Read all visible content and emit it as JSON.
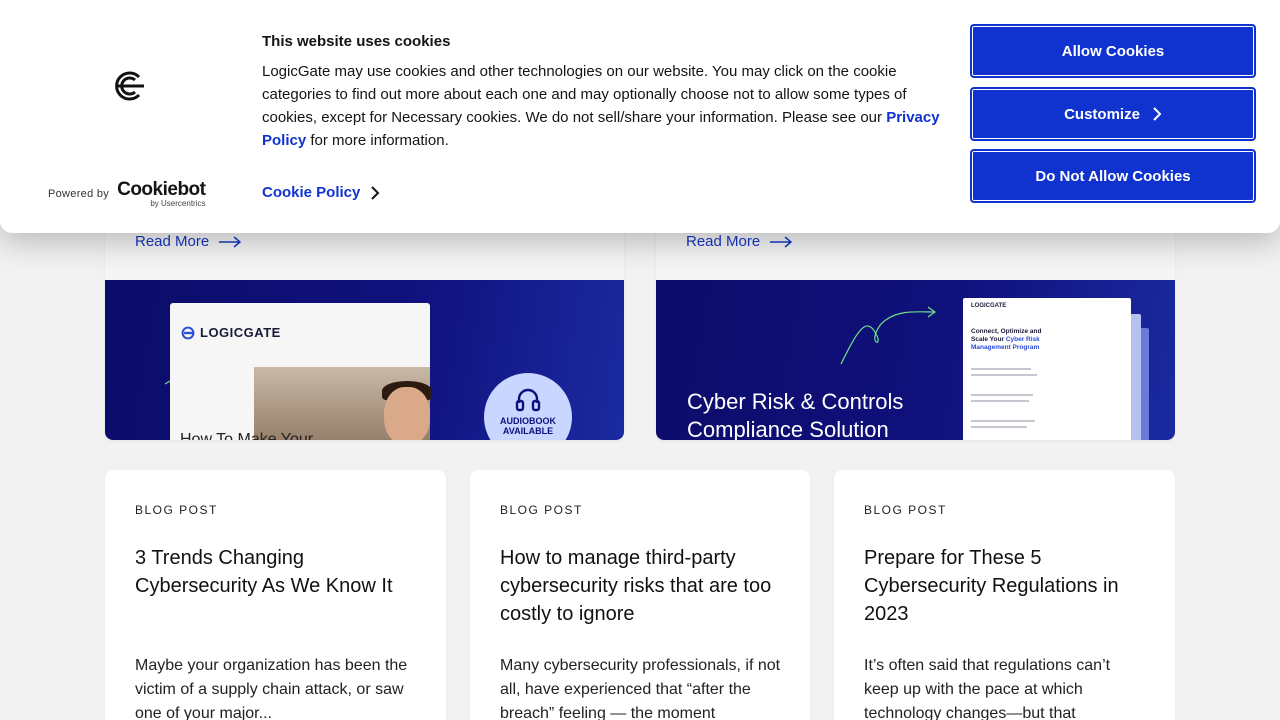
{
  "cookie_banner": {
    "title": "This website uses cookies",
    "body_before_link": "LogicGate may use cookies and other technologies on our website. You may click on the cookie categories to find out more about each one and may optionally choose not to allow some types of cookies, except for Necessary cookies.  We do not sell/share your information. Please see our ",
    "privacy_link": "Privacy Policy",
    "body_after_link": " for more information.",
    "cookie_policy_link": "Cookie Policy",
    "powered_by": "Powered by",
    "cookiebot_name": "Cookiebot",
    "cookiebot_sub": "by Usercentrics",
    "buttons": {
      "allow": "Allow Cookies",
      "customize": "Customize",
      "deny": "Do Not Allow Cookies"
    },
    "accent_color": "#1032cf"
  },
  "features": [
    {
      "read_more": "Read More",
      "logo_text": "LOGICGATE",
      "book_title": "How To Make Your",
      "badge_line1": "AUDIOBOOK",
      "badge_line2": "AVAILABLE"
    },
    {
      "read_more": "Read More",
      "headline_line1": "Cyber Risk & Controls",
      "headline_line2": "Compliance Solution",
      "doc_logo": "LOGICGATE",
      "doc_heading_a": "Connect, Optimize and Scale Your ",
      "doc_heading_b": "Cyber Risk Management Program"
    }
  ],
  "blog_posts": [
    {
      "eyebrow": "BLOG POST",
      "title": "3 Trends Changing Cybersecurity As We Know It",
      "excerpt": "Maybe your organization has been the victim of a supply chain attack, or saw one of your major..."
    },
    {
      "eyebrow": "BLOG POST",
      "title": "How to manage third-party cybersecurity risks that are too costly to ignore",
      "excerpt": "Many cybersecurity professionals, if not all, have experienced that “after the breach” feeling — the moment"
    },
    {
      "eyebrow": "BLOG POST",
      "title": "Prepare for These 5 Cybersecurity Regulations in 2023",
      "excerpt": "It’s often said that regulations can’t keep up with the pace at which technology changes—but that"
    }
  ]
}
